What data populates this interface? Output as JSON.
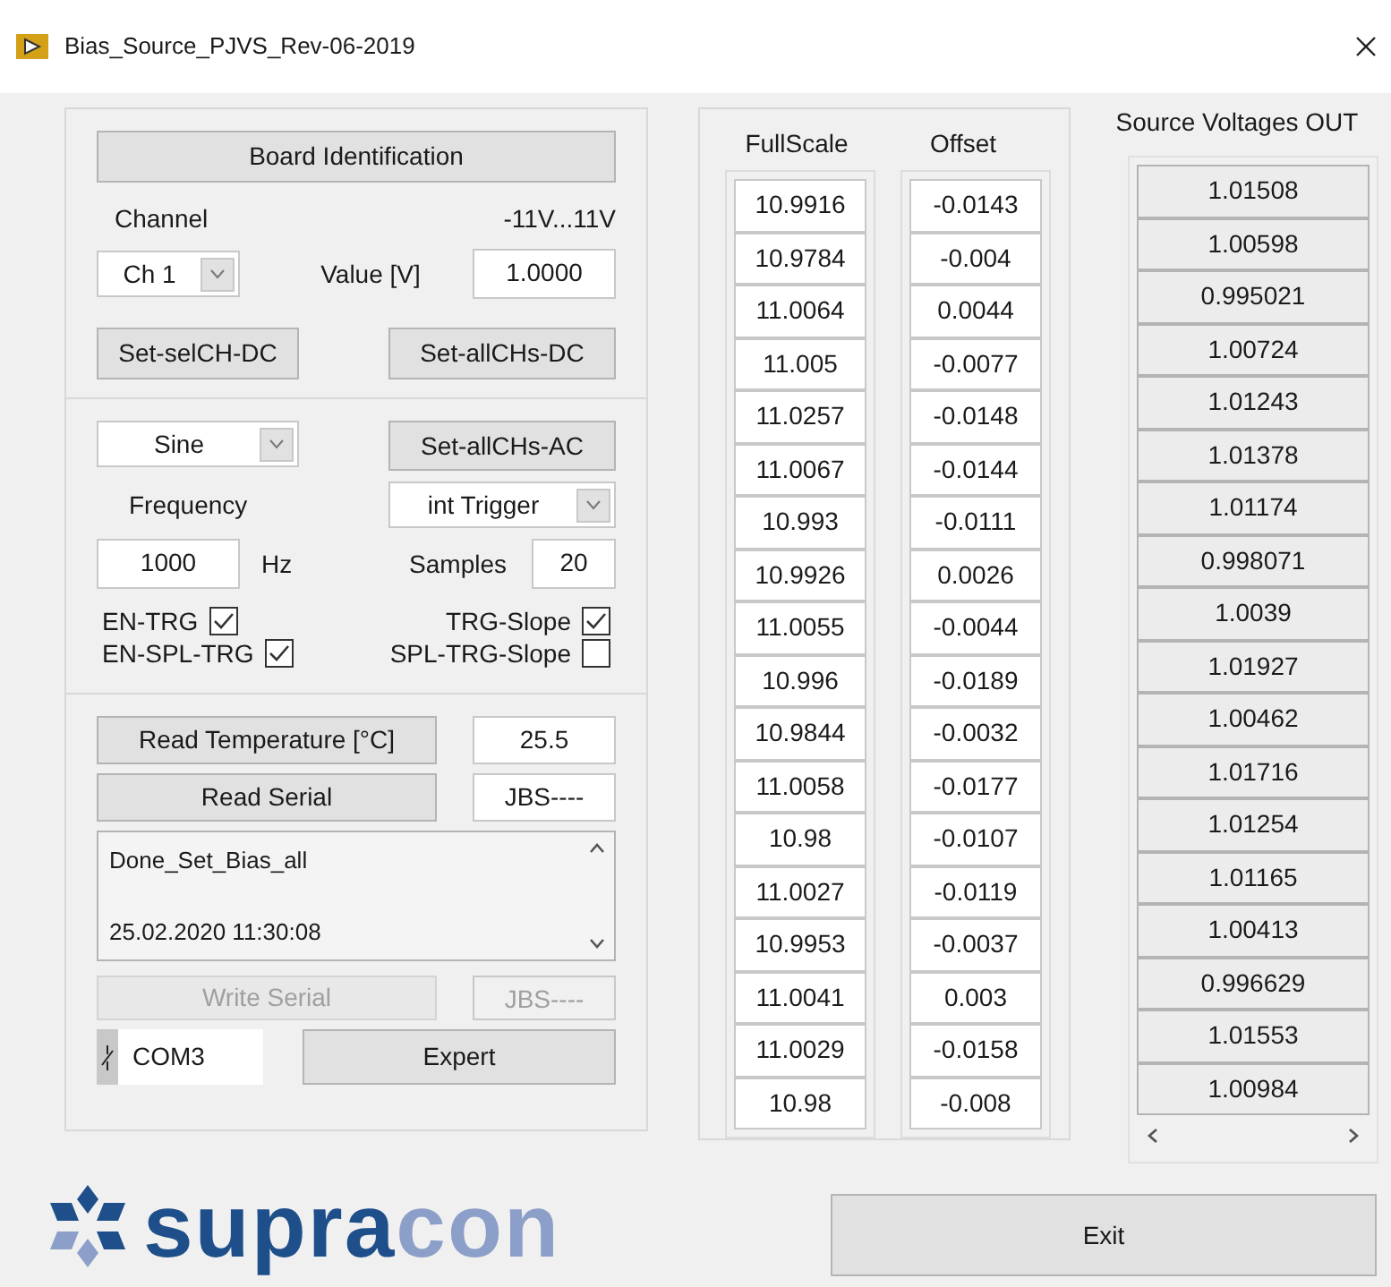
{
  "window": {
    "title": "Bias_Source_PJVS_Rev-06-2019"
  },
  "dc": {
    "board_button": "Board Identification",
    "channel_label": "Channel",
    "range_label": "-11V...11V",
    "channel_select": "Ch 1",
    "value_label": "Value [V]",
    "value": "1.0000",
    "set_sel_button": "Set-selCH-DC",
    "set_all_button": "Set-allCHs-DC"
  },
  "ac": {
    "waveform_select": "Sine",
    "set_all_button": "Set-allCHs-AC",
    "frequency_label": "Frequency",
    "trigger_select": "int Trigger",
    "frequency": "1000",
    "unit": "Hz",
    "samples_label": "Samples",
    "samples": "20",
    "checkboxes": [
      {
        "label": "EN-TRG",
        "checked": true
      },
      {
        "label": "TRG-Slope",
        "checked": true
      },
      {
        "label": "EN-SPL-TRG",
        "checked": true
      },
      {
        "label": "SPL-TRG-Slope",
        "checked": false
      }
    ]
  },
  "service": {
    "temperature_button": "Read Temperature [°C]",
    "temperature": "25.5",
    "read_serial_button": "Read Serial",
    "serial": "JBS----",
    "log": [
      "Done_Set_Bias_all",
      "25.02.2020 11:30:08"
    ],
    "write_serial": {
      "label": "Write Serial",
      "disabled": true
    },
    "write_serial_value": {
      "value": "JBS----",
      "disabled": true
    },
    "port": "COM3",
    "expert_button": "Expert"
  },
  "calibration": {
    "columns": [
      "FullScale",
      "Offset"
    ],
    "rows": [
      [
        "10.9916",
        "-0.0143"
      ],
      [
        "10.9784",
        "-0.004"
      ],
      [
        "11.0064",
        "0.0044"
      ],
      [
        "11.005",
        "-0.0077"
      ],
      [
        "11.0257",
        "-0.0148"
      ],
      [
        "11.0067",
        "-0.0144"
      ],
      [
        "10.993",
        "-0.0111"
      ],
      [
        "10.9926",
        "0.0026"
      ],
      [
        "11.0055",
        "-0.0044"
      ],
      [
        "10.996",
        "-0.0189"
      ],
      [
        "10.9844",
        "-0.0032"
      ],
      [
        "11.0058",
        "-0.0177"
      ],
      [
        "10.98",
        "-0.0107"
      ],
      [
        "11.0027",
        "-0.0119"
      ],
      [
        "10.9953",
        "-0.0037"
      ],
      [
        "11.0041",
        "0.003"
      ],
      [
        "11.0029",
        "-0.0158"
      ],
      [
        "10.98",
        "-0.008"
      ]
    ]
  },
  "outputs": {
    "title": "Source Voltages OUT",
    "values": [
      "1.01508",
      "1.00598",
      "0.995021",
      "1.00724",
      "1.01243",
      "1.01378",
      "1.01174",
      "0.998071",
      "1.0039",
      "1.01927",
      "1.00462",
      "1.01716",
      "1.01254",
      "1.01165",
      "1.00413",
      "0.996629",
      "1.01553",
      "1.00984"
    ]
  },
  "logo": {
    "dark": "supra",
    "light": "con"
  },
  "exit_button": "Exit"
}
